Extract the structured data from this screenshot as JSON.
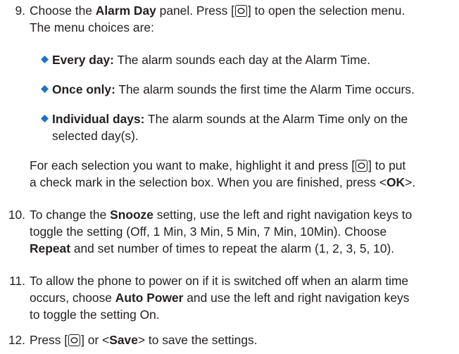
{
  "colors": {
    "text": "#231f20",
    "bullet": "#1a73c8"
  },
  "icons": {
    "select_key": "select-key-icon",
    "bullet": "diamond-bullet-icon"
  },
  "step9": {
    "number": "9.",
    "line1_a": "Choose the ",
    "line1_b": "Alarm Day",
    "line1_c": " panel. Press [",
    "line1_d": "] to open the selection menu.",
    "line2": "The menu choices are:",
    "bullets": [
      {
        "term": "Every day:",
        "line1": " The alarm sounds each day at the Alarm Time.",
        "line2": ""
      },
      {
        "term": "Once only:",
        "line1": " The alarm sounds the first time the Alarm Time occurs.",
        "line2": ""
      },
      {
        "term": "Individual days:",
        "line1": " The alarm sounds at the Alarm Time only on the",
        "line2": "selected day(s)."
      }
    ],
    "para_line1_a": "For each selection you want to make, highlight it and press [",
    "para_line1_b": "] to put",
    "para_line2_a": "a check mark in the selection box. When you are finished, press <",
    "para_line2_b": "OK",
    "para_line2_c": ">."
  },
  "step10": {
    "number": "10.",
    "line1_a": "To change the ",
    "line1_b": "Snooze",
    "line1_c": " setting, use the left and right navigation keys to",
    "line2": "toggle the setting (Off, 1 Min, 3 Min, 5 Min, 7 Min, 10Min). Choose",
    "line3_a": "Repeat",
    "line3_b": " and set number of times to repeat the alarm (1, 2, 3, 5, 10)."
  },
  "step11": {
    "number": "11.",
    "line1": "To allow the phone to power on if it is switched off when an alarm time",
    "line2_a": "occurs, choose ",
    "line2_b": "Auto Power",
    "line2_c": " and use the left and right navigation keys",
    "line3": "to toggle the setting On."
  },
  "step12": {
    "number": "12.",
    "line1_a": "Press [",
    "line1_b": "] or <",
    "line1_c": "Save",
    "line1_d": "> to save the settings."
  }
}
